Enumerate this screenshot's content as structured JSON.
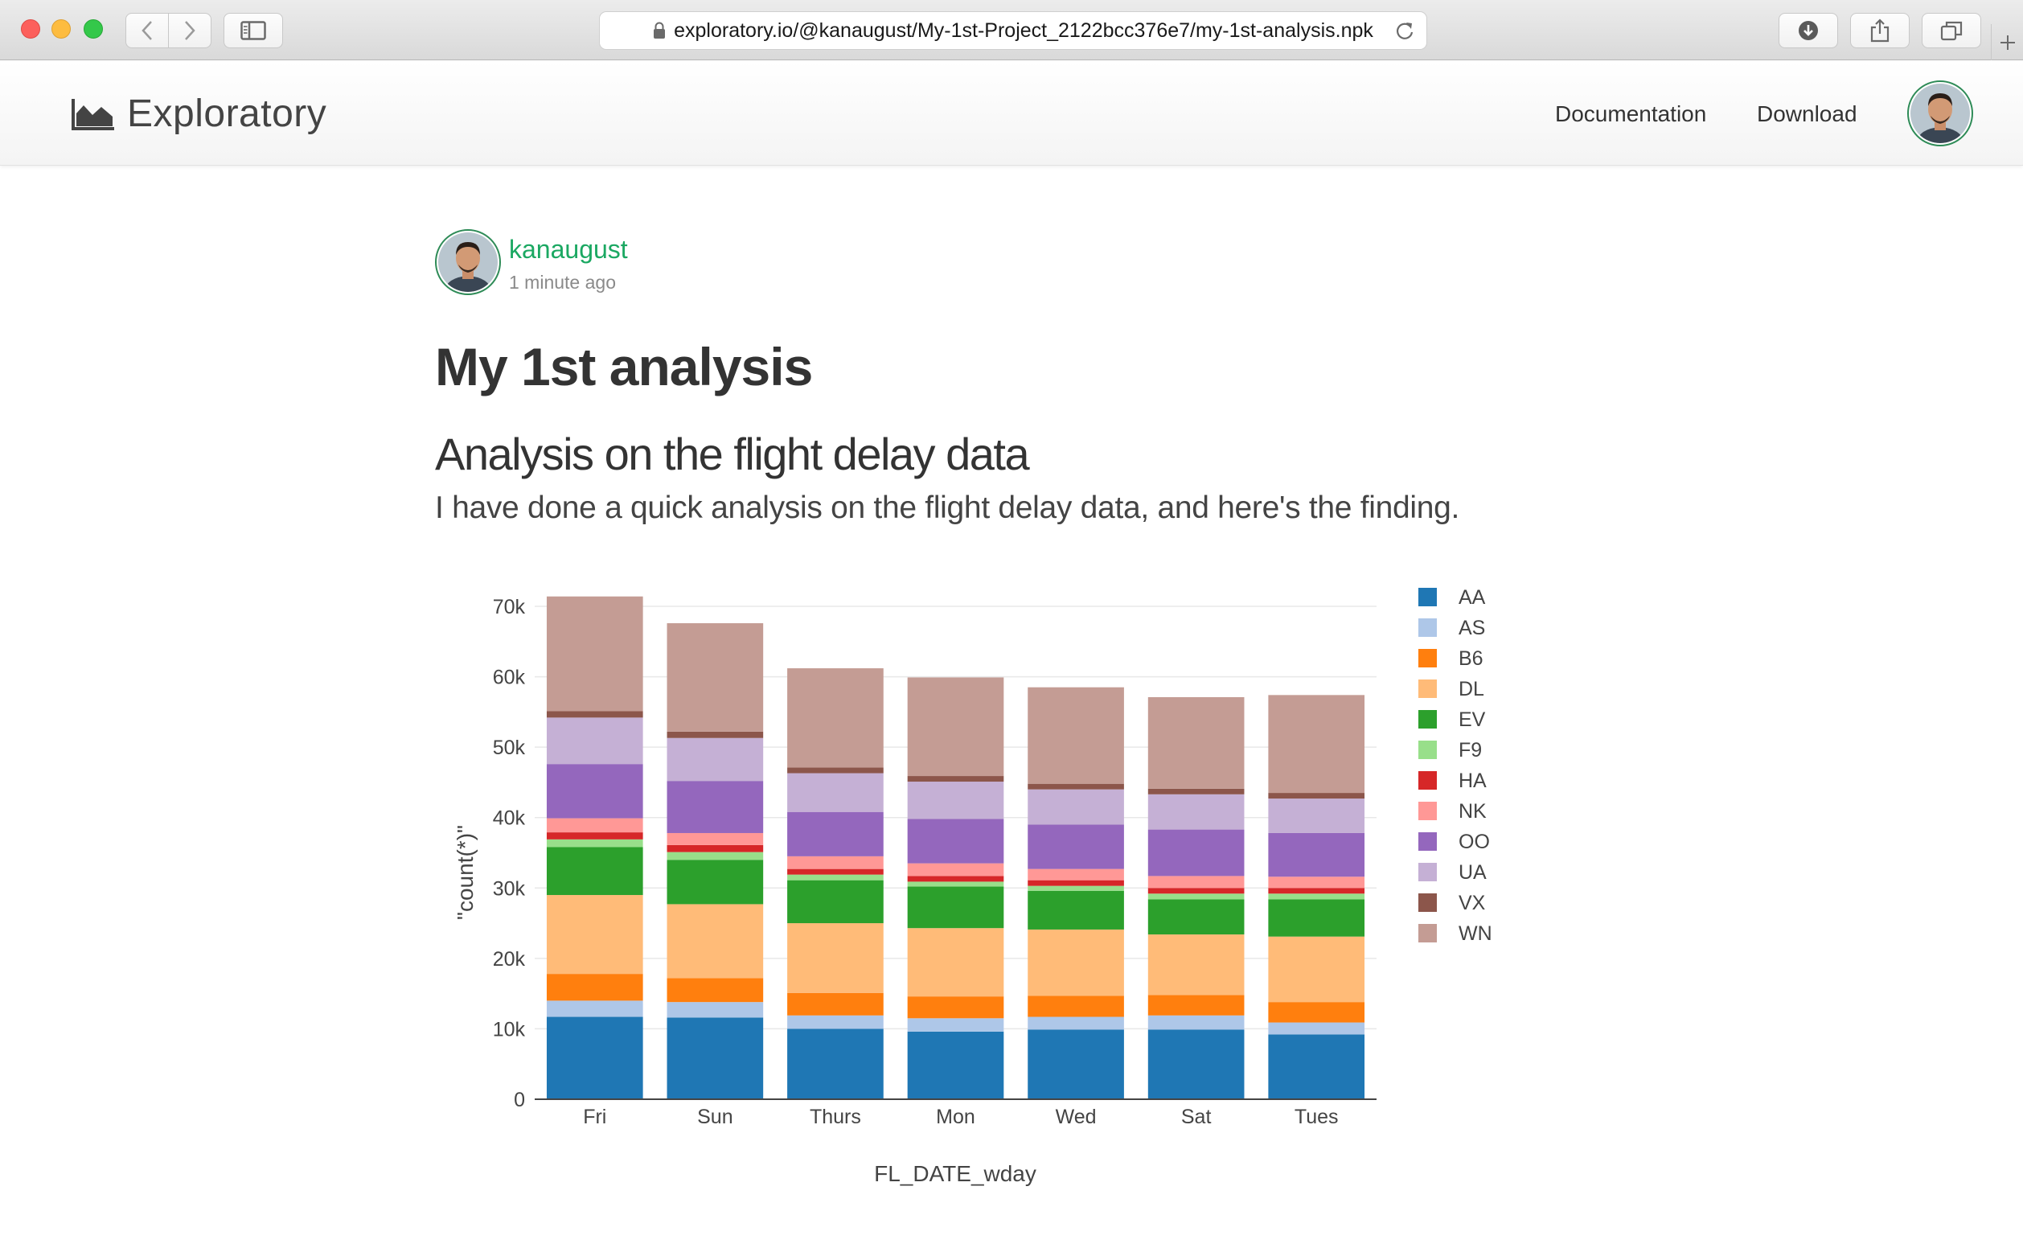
{
  "browser": {
    "url": "exploratory.io/@kanaugust/My-1st-Project_2122bcc376e7/my-1st-analysis.npk",
    "buttons": [
      "back",
      "forward",
      "sidebar",
      "reload",
      "downloads",
      "share",
      "tabs",
      "new-tab"
    ]
  },
  "header": {
    "brand": "Exploratory",
    "nav": {
      "documentation": "Documentation",
      "download": "Download"
    }
  },
  "post": {
    "author": "kanaugust",
    "time": "1 minute ago",
    "title": "My 1st analysis",
    "section_heading": "Analysis on the flight delay data",
    "section_text": "I have done a quick analysis on the flight delay data, and here's the finding."
  },
  "colors": {
    "accent_green": "#1ba862",
    "AA": "#1f77b4",
    "AS": "#aec7e8",
    "B6": "#ff7f0e",
    "DL": "#ffbb78",
    "EV": "#2ca02c",
    "F9": "#98df8a",
    "HA": "#d62728",
    "NK": "#ff9896",
    "OO": "#9467bd",
    "UA": "#c5b0d5",
    "VX": "#8c564b",
    "WN": "#c49c94"
  },
  "chart_data": {
    "type": "bar",
    "stacked": true,
    "xlabel": "FL_DATE_wday",
    "ylabel": "\"count(*)\"",
    "ylim": [
      0,
      70000
    ],
    "y_ticks": [
      "0",
      "10k",
      "20k",
      "30k",
      "40k",
      "50k",
      "60k",
      "70k"
    ],
    "grid": true,
    "legend_position": "right",
    "categories": [
      "Fri",
      "Sun",
      "Thurs",
      "Mon",
      "Wed",
      "Sat",
      "Tues"
    ],
    "series": [
      {
        "name": "AA",
        "values": [
          11700,
          11600,
          10000,
          9600,
          9900,
          9900,
          9200
        ]
      },
      {
        "name": "AS",
        "values": [
          2300,
          2200,
          1900,
          1900,
          1800,
          2000,
          1700
        ]
      },
      {
        "name": "B6",
        "values": [
          3800,
          3400,
          3200,
          3100,
          3000,
          2900,
          2900
        ]
      },
      {
        "name": "DL",
        "values": [
          11200,
          10500,
          9900,
          9700,
          9400,
          8600,
          9300
        ]
      },
      {
        "name": "EV",
        "values": [
          6800,
          6300,
          6100,
          5900,
          5500,
          5000,
          5300
        ]
      },
      {
        "name": "F9",
        "values": [
          1100,
          1100,
          800,
          700,
          700,
          800,
          800
        ]
      },
      {
        "name": "HA",
        "values": [
          1000,
          1000,
          800,
          800,
          800,
          800,
          800
        ]
      },
      {
        "name": "NK",
        "values": [
          2000,
          1700,
          1800,
          1800,
          1600,
          1700,
          1600
        ]
      },
      {
        "name": "OO",
        "values": [
          7700,
          7400,
          6300,
          6300,
          6300,
          6600,
          6200
        ]
      },
      {
        "name": "UA",
        "values": [
          6600,
          6100,
          5500,
          5300,
          5000,
          5000,
          4900
        ]
      },
      {
        "name": "VX",
        "values": [
          900,
          900,
          800,
          800,
          800,
          800,
          800
        ]
      },
      {
        "name": "WN",
        "values": [
          16300,
          15400,
          14100,
          14000,
          13700,
          13000,
          13900
        ]
      }
    ]
  }
}
